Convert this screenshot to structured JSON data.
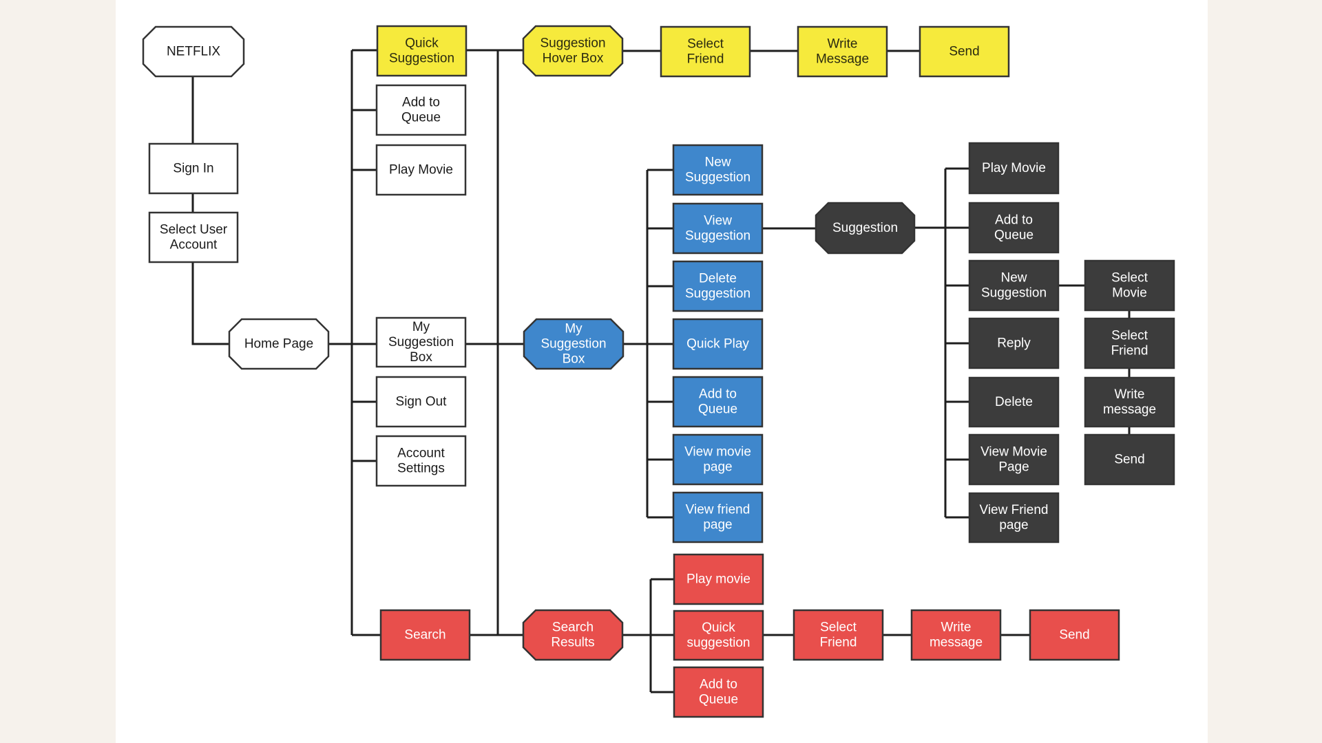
{
  "diagram": {
    "title": "NETFLIX",
    "colors": {
      "page_background": "#f6f2ec",
      "canvas": "#ffffff",
      "connector": "#1e1e1e",
      "white_fill": "#ffffff",
      "white_text": "#1a1a1a",
      "yellow_fill": "#f6ea3c",
      "yellow_text": "#2a2a10",
      "blue_fill": "#3f87cc",
      "blue_text": "#ffffff",
      "dark_fill": "#3c3c3c",
      "dark_text": "#ffffff",
      "red_fill": "#e84f4c",
      "red_text": "#ffffff",
      "border": "#333333"
    },
    "nodes": [
      {
        "id": "netflix",
        "shape": "octagon",
        "style": "white",
        "lines": [
          "NETFLIX"
        ]
      },
      {
        "id": "sign_in",
        "shape": "rect",
        "style": "white",
        "lines": [
          "Sign In"
        ]
      },
      {
        "id": "select_user",
        "shape": "rect",
        "style": "white",
        "lines": [
          "Select User",
          "Account"
        ]
      },
      {
        "id": "home_page",
        "shape": "octagon",
        "style": "white",
        "lines": [
          "Home Page"
        ]
      },
      {
        "id": "quick_suggestion",
        "shape": "rect",
        "style": "yellow",
        "lines": [
          "Quick",
          "Suggestion"
        ]
      },
      {
        "id": "add_queue_home",
        "shape": "rect",
        "style": "white",
        "lines": [
          "Add to",
          "Queue"
        ]
      },
      {
        "id": "play_movie_home",
        "shape": "rect",
        "style": "white",
        "lines": [
          "Play Movie"
        ]
      },
      {
        "id": "my_suggestion_box_home",
        "shape": "rect",
        "style": "white",
        "lines": [
          "My",
          "Suggestion",
          "Box"
        ]
      },
      {
        "id": "sign_out",
        "shape": "rect",
        "style": "white",
        "lines": [
          "Sign Out"
        ]
      },
      {
        "id": "account_settings",
        "shape": "rect",
        "style": "white",
        "lines": [
          "Account",
          "Settings"
        ]
      },
      {
        "id": "search",
        "shape": "rect",
        "style": "red",
        "lines": [
          "Search"
        ]
      },
      {
        "id": "hover_box",
        "shape": "octagon",
        "style": "yellow",
        "lines": [
          "Suggestion",
          "Hover Box"
        ]
      },
      {
        "id": "y_select_friend",
        "shape": "rect",
        "style": "yellow",
        "lines": [
          "Select",
          "Friend"
        ]
      },
      {
        "id": "y_write_message",
        "shape": "rect",
        "style": "yellow",
        "lines": [
          "Write",
          "Message"
        ]
      },
      {
        "id": "y_send",
        "shape": "rect",
        "style": "yellow",
        "lines": [
          "Send"
        ]
      },
      {
        "id": "my_suggestion_box",
        "shape": "octagon",
        "style": "blue",
        "lines": [
          "My",
          "Suggestion",
          "Box"
        ]
      },
      {
        "id": "b_new_suggestion",
        "shape": "rect",
        "style": "blue",
        "lines": [
          "New",
          "Suggestion"
        ]
      },
      {
        "id": "b_view_suggestion",
        "shape": "rect",
        "style": "blue",
        "lines": [
          "View",
          "Suggestion"
        ]
      },
      {
        "id": "b_delete_suggestion",
        "shape": "rect",
        "style": "blue",
        "lines": [
          "Delete",
          "Suggestion"
        ]
      },
      {
        "id": "b_quick_play",
        "shape": "rect",
        "style": "blue",
        "lines": [
          "Quick Play"
        ]
      },
      {
        "id": "b_add_queue",
        "shape": "rect",
        "style": "blue",
        "lines": [
          "Add to",
          "Queue"
        ]
      },
      {
        "id": "b_view_movie",
        "shape": "rect",
        "style": "blue",
        "lines": [
          "View movie",
          "page"
        ]
      },
      {
        "id": "b_view_friend",
        "shape": "rect",
        "style": "blue",
        "lines": [
          "View friend",
          "page"
        ]
      },
      {
        "id": "suggestion",
        "shape": "octagon",
        "style": "dark",
        "lines": [
          "Suggestion"
        ]
      },
      {
        "id": "d_play_movie",
        "shape": "rect",
        "style": "dark",
        "lines": [
          "Play Movie"
        ]
      },
      {
        "id": "d_add_queue",
        "shape": "rect",
        "style": "dark",
        "lines": [
          "Add to",
          "Queue"
        ]
      },
      {
        "id": "d_new_suggestion",
        "shape": "rect",
        "style": "dark",
        "lines": [
          "New",
          "Suggestion"
        ]
      },
      {
        "id": "d_reply",
        "shape": "rect",
        "style": "dark",
        "lines": [
          "Reply"
        ]
      },
      {
        "id": "d_delete",
        "shape": "rect",
        "style": "dark",
        "lines": [
          "Delete"
        ]
      },
      {
        "id": "d_view_movie",
        "shape": "rect",
        "style": "dark",
        "lines": [
          "View Movie",
          "Page"
        ]
      },
      {
        "id": "d_view_friend",
        "shape": "rect",
        "style": "dark",
        "lines": [
          "View Friend",
          "page"
        ]
      },
      {
        "id": "d_select_movie",
        "shape": "rect",
        "style": "dark",
        "lines": [
          "Select",
          "Movie"
        ]
      },
      {
        "id": "d_select_friend",
        "shape": "rect",
        "style": "dark",
        "lines": [
          "Select",
          "Friend"
        ]
      },
      {
        "id": "d_write_message",
        "shape": "rect",
        "style": "dark",
        "lines": [
          "Write",
          "message"
        ]
      },
      {
        "id": "d_send",
        "shape": "rect",
        "style": "dark",
        "lines": [
          "Send"
        ]
      },
      {
        "id": "search_results",
        "shape": "octagon",
        "style": "red",
        "lines": [
          "Search",
          "Results"
        ]
      },
      {
        "id": "r_play_movie",
        "shape": "rect",
        "style": "red",
        "lines": [
          "Play movie"
        ]
      },
      {
        "id": "r_quick_suggestion",
        "shape": "rect",
        "style": "red",
        "lines": [
          "Quick",
          "suggestion"
        ]
      },
      {
        "id": "r_add_queue",
        "shape": "rect",
        "style": "red",
        "lines": [
          "Add to",
          "Queue"
        ]
      },
      {
        "id": "r_select_friend",
        "shape": "rect",
        "style": "red",
        "lines": [
          "Select",
          "Friend"
        ]
      },
      {
        "id": "r_write_message",
        "shape": "rect",
        "style": "red",
        "lines": [
          "Write",
          "message"
        ]
      },
      {
        "id": "r_send",
        "shape": "rect",
        "style": "red",
        "lines": [
          "Send"
        ]
      }
    ],
    "edges": [
      [
        "netflix",
        "sign_in"
      ],
      [
        "sign_in",
        "select_user"
      ],
      [
        "select_user",
        "home_page"
      ],
      [
        "home_page",
        "quick_suggestion"
      ],
      [
        "home_page",
        "add_queue_home"
      ],
      [
        "home_page",
        "play_movie_home"
      ],
      [
        "home_page",
        "my_suggestion_box_home"
      ],
      [
        "home_page",
        "sign_out"
      ],
      [
        "home_page",
        "account_settings"
      ],
      [
        "home_page",
        "search"
      ],
      [
        "quick_suggestion",
        "hover_box"
      ],
      [
        "hover_box",
        "y_select_friend"
      ],
      [
        "y_select_friend",
        "y_write_message"
      ],
      [
        "y_write_message",
        "y_send"
      ],
      [
        "my_suggestion_box_home",
        "my_suggestion_box"
      ],
      [
        "search",
        "search_results"
      ],
      [
        "my_suggestion_box",
        "b_new_suggestion"
      ],
      [
        "my_suggestion_box",
        "b_view_suggestion"
      ],
      [
        "my_suggestion_box",
        "b_delete_suggestion"
      ],
      [
        "my_suggestion_box",
        "b_quick_play"
      ],
      [
        "my_suggestion_box",
        "b_add_queue"
      ],
      [
        "my_suggestion_box",
        "b_view_movie"
      ],
      [
        "my_suggestion_box",
        "b_view_friend"
      ],
      [
        "b_view_suggestion",
        "suggestion"
      ],
      [
        "suggestion",
        "d_play_movie"
      ],
      [
        "suggestion",
        "d_add_queue"
      ],
      [
        "suggestion",
        "d_new_suggestion"
      ],
      [
        "suggestion",
        "d_reply"
      ],
      [
        "suggestion",
        "d_delete"
      ],
      [
        "suggestion",
        "d_view_movie"
      ],
      [
        "suggestion",
        "d_view_friend"
      ],
      [
        "d_new_suggestion",
        "d_select_movie"
      ],
      [
        "d_select_movie",
        "d_select_friend"
      ],
      [
        "d_select_friend",
        "d_write_message"
      ],
      [
        "d_write_message",
        "d_send"
      ],
      [
        "search_results",
        "r_play_movie"
      ],
      [
        "search_results",
        "r_quick_suggestion"
      ],
      [
        "search_results",
        "r_add_queue"
      ],
      [
        "r_quick_suggestion",
        "r_select_friend"
      ],
      [
        "r_select_friend",
        "r_write_message"
      ],
      [
        "r_write_message",
        "r_send"
      ]
    ]
  }
}
